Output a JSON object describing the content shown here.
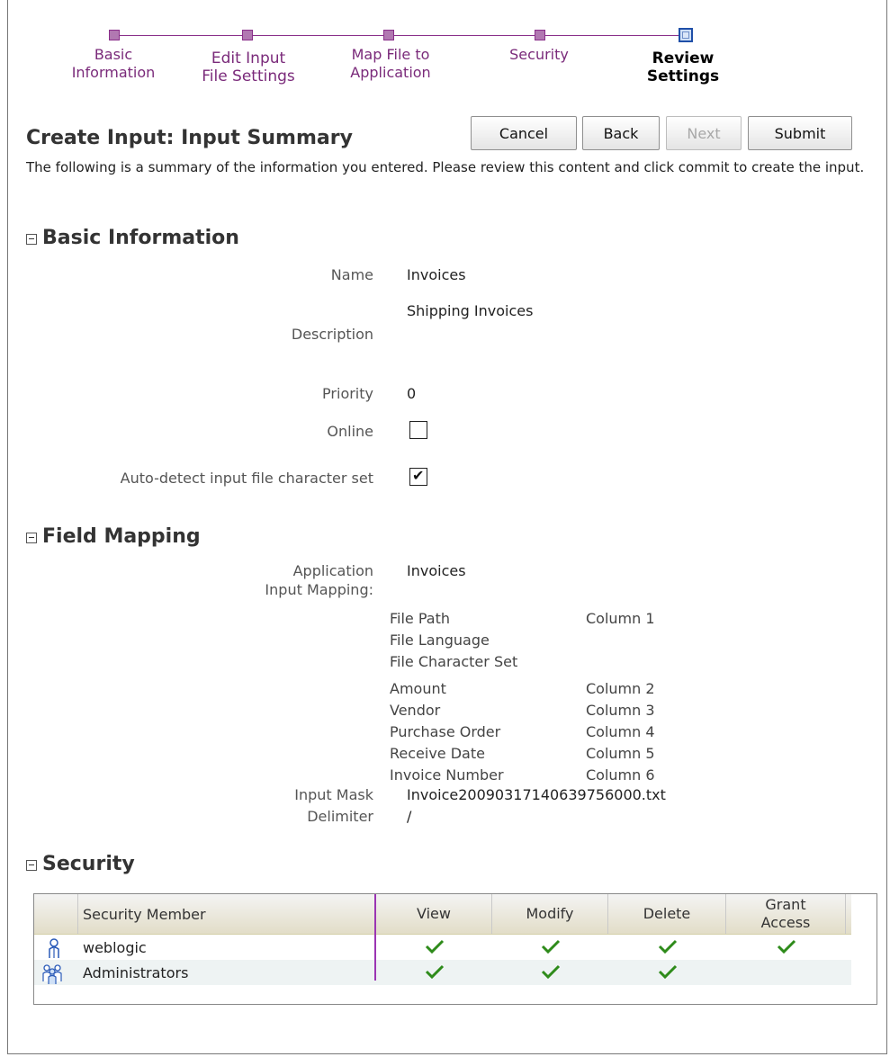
{
  "train": {
    "steps": [
      {
        "label": "Basic\nInformation",
        "current": false
      },
      {
        "label": "Edit Input\nFile Settings",
        "current": false
      },
      {
        "label": "Map File to\nApplication",
        "current": false
      },
      {
        "label": "Security",
        "current": false
      },
      {
        "label": "Review\nSettings",
        "current": true
      }
    ]
  },
  "header": {
    "title": "Create Input: Input Summary",
    "buttons": {
      "cancel": "Cancel",
      "back": "Back",
      "next": "Next",
      "submit": "Submit"
    },
    "intro": "The following is a summary of the information you entered. Please review this content and click commit to create the input."
  },
  "basic": {
    "title": "Basic Information",
    "name_label": "Name",
    "name_value": "Invoices",
    "description_label": "Description",
    "description_value": "Shipping Invoices",
    "priority_label": "Priority",
    "priority_value": "0",
    "online_label": "Online",
    "online_checked": false,
    "autodetect_label": "Auto-detect input file character set",
    "autodetect_checked": true
  },
  "field_mapping": {
    "title": "Field Mapping",
    "application_label": "Application",
    "application_value": "Invoices",
    "input_mapping_label": "Input Mapping:",
    "mappings": [
      {
        "name": "File Path",
        "column": "Column 1"
      },
      {
        "name": "File Language",
        "column": ""
      },
      {
        "name": "File Character Set",
        "column": ""
      },
      {
        "name": "Amount",
        "column": "Column 2"
      },
      {
        "name": "Vendor",
        "column": "Column 3"
      },
      {
        "name": "Purchase Order",
        "column": "Column 4"
      },
      {
        "name": "Receive Date",
        "column": "Column 5"
      },
      {
        "name": "Invoice Number",
        "column": "Column 6"
      }
    ],
    "input_mask_label": "Input Mask",
    "input_mask_value": "Invoice20090317140639756000.txt",
    "delimiter_label": "Delimiter",
    "delimiter_value": "/"
  },
  "security": {
    "title": "Security",
    "columns": {
      "member": "Security Member",
      "view": "View",
      "modify": "Modify",
      "delete": "Delete",
      "grant": "Grant\nAccess"
    },
    "rows": [
      {
        "member": "weblogic",
        "icon": "user-icon",
        "view": true,
        "modify": true,
        "delete": true,
        "grant": true
      },
      {
        "member": "Administrators",
        "icon": "group-icon",
        "view": true,
        "modify": true,
        "delete": true,
        "grant": false
      }
    ]
  },
  "colors": {
    "train_accent": "#8a2f8a",
    "check_green": "#2e8b1a"
  }
}
